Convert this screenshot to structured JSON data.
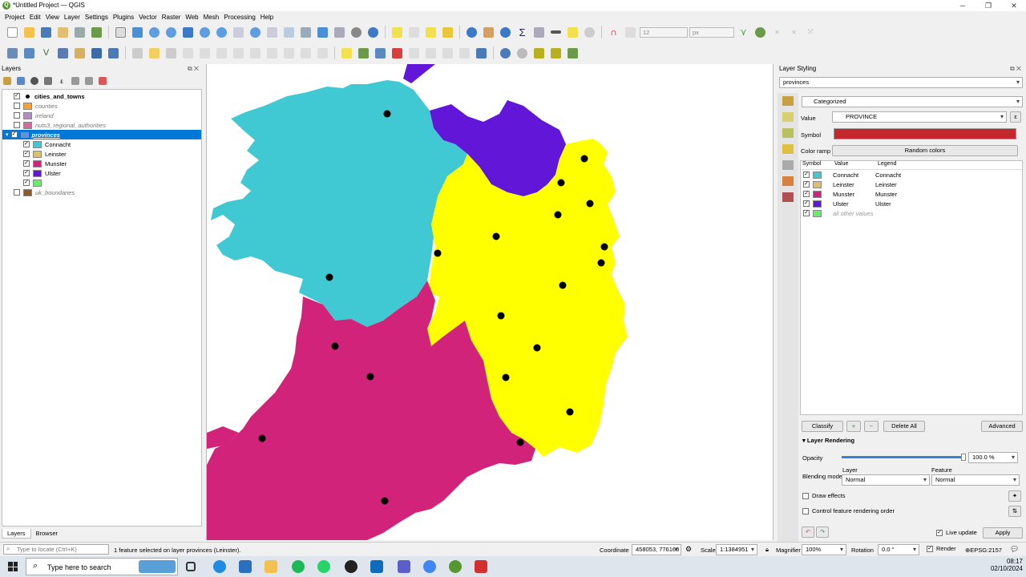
{
  "window": {
    "title": "*Untitled Project — QGIS"
  },
  "menu": [
    "Project",
    "Edit",
    "View",
    "Layer",
    "Settings",
    "Plugins",
    "Vector",
    "Raster",
    "Web",
    "Mesh",
    "Processing",
    "Help"
  ],
  "toolbar": {
    "font_size": "12",
    "font_unit": "px"
  },
  "layers_panel": {
    "title": "Layers",
    "tabs": [
      "Layers",
      "Browser"
    ],
    "items": [
      {
        "name": "cities_and_towns",
        "checked": true,
        "bold": true,
        "color": "#000000"
      },
      {
        "name": "counties",
        "checked": false,
        "color": "#f4a13a"
      },
      {
        "name": "ireland",
        "checked": false,
        "color": "#b38bc9"
      },
      {
        "name": "nuts3_regional_authorities",
        "checked": false,
        "color": "#d06b9a"
      },
      {
        "name": "provinces",
        "checked": true,
        "color": "#6b8fd0"
      },
      {
        "name": "Connacht",
        "checked": true,
        "color": "#41c9d3"
      },
      {
        "name": "Leinster",
        "checked": true,
        "color": "#ffff00"
      },
      {
        "name": "Munster",
        "checked": true,
        "color": "#d2237b"
      },
      {
        "name": "Ulster",
        "checked": true,
        "color": "#6217d8"
      },
      {
        "name": "",
        "checked": true,
        "color": "#66ee66"
      },
      {
        "name": "uk_boundaries",
        "checked": false,
        "color": "#8b5a2b"
      }
    ]
  },
  "styling": {
    "title": "Layer Styling",
    "layer": "provinces",
    "renderer": "Categorized",
    "value_label": "Value",
    "value": "PROVINCE",
    "symbol_label": "Symbol",
    "symbol_color": "#c4272d",
    "color_ramp_label": "Color ramp",
    "color_ramp": "Random colors",
    "table_headers": [
      "Symbol",
      "Value",
      "Legend"
    ],
    "categories": [
      {
        "value": "Connacht",
        "legend": "Connacht",
        "color": "#41c9d3"
      },
      {
        "value": "Leinster",
        "legend": "Leinster",
        "color": "#d9c36a"
      },
      {
        "value": "Munster",
        "legend": "Munster",
        "color": "#d2237b"
      },
      {
        "value": "Ulster",
        "legend": "Ulster",
        "color": "#6217d8"
      },
      {
        "value": "",
        "legend": "all other values",
        "color": "#66ee66"
      }
    ],
    "classify": "Classify",
    "delete_all": "Delete All",
    "advanced": "Advanced",
    "layer_rendering": "Layer Rendering",
    "opacity_label": "Opacity",
    "opacity": "100.0 %",
    "opacity_fraction": 1.0,
    "blending_label": "Blending mode",
    "blend_layer_label": "Layer",
    "blend_feature_label": "Feature",
    "blend_layer": "Normal",
    "blend_feature": "Normal",
    "draw_effects": "Draw effects",
    "control_order": "Control feature rendering order",
    "live_update": "Live update",
    "apply": "Apply"
  },
  "status": {
    "locate_placeholder": "Type to locate (Ctrl+K)",
    "message": "1 feature selected on layer provinces (Leinster).",
    "coordinate_label": "Coordinate",
    "coordinate": "458053, 776160",
    "scale_label": "Scale",
    "scale": "1:1384951",
    "magnifier_label": "Magnifier",
    "magnifier": "100%",
    "rotation_label": "Rotation",
    "rotation": "0.0 °",
    "render": "Render",
    "epsg": "EPSG:2157"
  },
  "taskbar": {
    "search": "Type here to search",
    "time": "08:17",
    "date": "02/10/2024"
  }
}
